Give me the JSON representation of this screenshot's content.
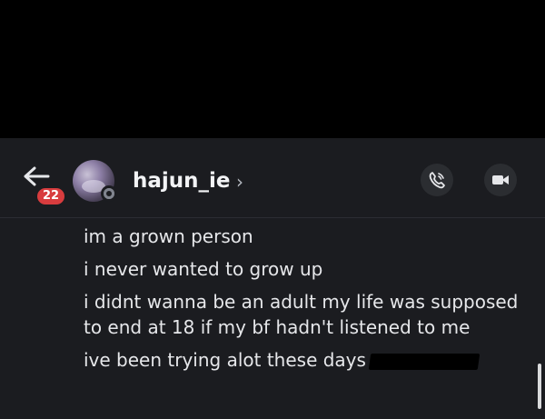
{
  "header": {
    "unread_count": "22",
    "username": "hajun_ie",
    "chevron": "›",
    "icons": {
      "back": "arrow-left-icon",
      "call": "phone-icon",
      "video": "video-camera-icon"
    }
  },
  "messages": [
    {
      "text": "im a grown person"
    },
    {
      "text": "i never wanted to grow up"
    },
    {
      "text": "i didnt wanna be an adult my life was supposed to end at 18 if my bf hadn't listened to me"
    },
    {
      "text": "ive been trying alot these days"
    }
  ],
  "colors": {
    "background": "#1b1c20",
    "badge": "#d83c3e",
    "text": "#e6e7ea"
  }
}
